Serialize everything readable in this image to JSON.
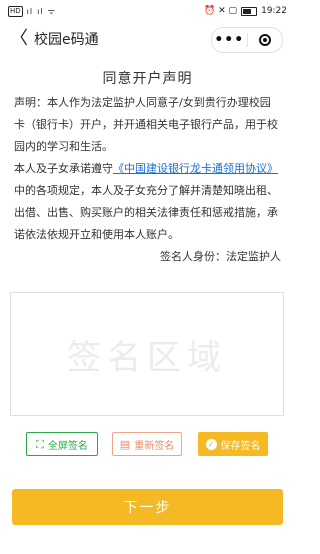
{
  "status_bar": {
    "left_badge": "HD",
    "signal_1": "ıl",
    "signal_2": "ıl",
    "wifi": "ᯤ",
    "right_icons": "⏰ ✕ ▢",
    "time": "19:22"
  },
  "nav": {
    "back_icon": "〈",
    "title": "校园e码通",
    "more_icon": "•••"
  },
  "page": {
    "title": "同意开户声明",
    "paragraph1": "声明：本人作为法定监护人同意子/女到贵行办理校园卡（银行卡）开户，并开通相关电子银行产品，用于校园内的学习和生活。",
    "paragraph2_prefix": "本人及子女承诺遵守",
    "agreement_link": "《中国建设银行龙卡通领用协议》",
    "paragraph2_suffix": "中的各项规定，本人及子女充分了解并清楚知晓出租、出借、出售、购买账户的相关法律责任和惩戒措施，承诺依法依规开立和使用本人账户。",
    "signer": "签名人身份：法定监护人"
  },
  "signature": {
    "placeholder": "签名区域"
  },
  "buttons": {
    "fullscreen": "全屏签名",
    "reset": "重新签名",
    "save": "保存签名",
    "next": "下一步"
  },
  "colors": {
    "accent": "#f5b923",
    "green": "#2aa84a",
    "orange": "#ec8a66",
    "link": "#1a6fd6"
  }
}
